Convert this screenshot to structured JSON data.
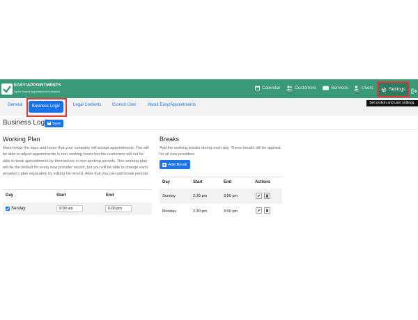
{
  "header": {
    "brand": "EASY!APPOINTMENTS",
    "tagline": "Open Source Appointment Scheduler",
    "nav": [
      {
        "label": "Calendar",
        "icon": "calendar-icon"
      },
      {
        "label": "Customers",
        "icon": "users-icon"
      },
      {
        "label": "Services",
        "icon": "services-icon"
      },
      {
        "label": "Users",
        "icon": "user-icon"
      },
      {
        "label": "Settings",
        "icon": "gear-icon"
      }
    ],
    "tooltip": "Set system and user settings."
  },
  "tabs": [
    {
      "label": "General"
    },
    {
      "label": "Business Logic"
    },
    {
      "label": "Legal Contents"
    },
    {
      "label": "Current User"
    },
    {
      "label": "About Easy!Appointments"
    }
  ],
  "page": {
    "title": "Business Logic",
    "save_label": "Save"
  },
  "working_plan": {
    "title": "Working Plan",
    "description": "Mark below the days and hours that your company will accept appointments. You will be able to adjust appointments in non-working hours but the customers will not be able to book appointments by themselves in non-working periods. This working plan will be the default for every new provider record, but you will be able to change each provider's plan separately by editing his record. After that you can add break periods.",
    "columns": [
      "Day",
      "Start",
      "End"
    ],
    "rows": [
      {
        "day": "Sunday",
        "checked": true,
        "start": "9:00 am",
        "end": "6:00 pm"
      }
    ]
  },
  "breaks": {
    "title": "Breaks",
    "description": "Add the working breaks during each day. These breaks will be applied for all new providers.",
    "add_label": "Add Break",
    "columns": [
      "Day",
      "Start",
      "End",
      "Actions"
    ],
    "rows": [
      {
        "day": "Sunday",
        "start": "2:30 pm",
        "end": "3:00 pm"
      },
      {
        "day": "Monday",
        "start": "2:30 pm",
        "end": "3:00 pm"
      }
    ]
  },
  "colors": {
    "header": "#3a9a78",
    "accent": "#1a73e8",
    "highlight": "#e53935"
  }
}
